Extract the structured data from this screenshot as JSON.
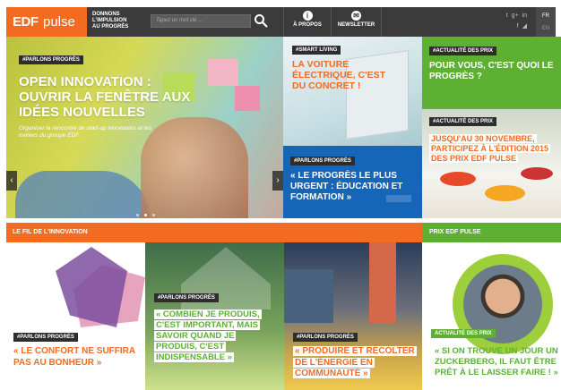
{
  "header": {
    "logo_edf": "EDF",
    "logo_pulse": "pulse",
    "tagline_lines": [
      "DONNONS",
      "L'IMPULSION",
      "AU PROGRÈS"
    ],
    "search_placeholder": "Tapez un mot clé ...",
    "nav": [
      {
        "label": "À PROPOS",
        "icon": "info-icon"
      },
      {
        "label": "NEWSLETTER",
        "icon": "mail-icon"
      }
    ],
    "social": [
      "twitter-icon",
      "google-plus-icon",
      "linkedin-icon",
      "facebook-icon",
      "rss-icon"
    ],
    "languages": {
      "active": "FR",
      "other": "EN"
    }
  },
  "hero": {
    "tag": "#PARLONS PROGRÈS",
    "title": "OPEN INNOVATION : OUVRIR LA FENÊTRE AUX IDÉES NOUVELLES",
    "description": "Organiser la rencontre de start-up innovantes et les métiers du groupe EDF.",
    "prev": "‹",
    "next": "›",
    "slides": 3,
    "active_slide": 2
  },
  "tiles": {
    "smart_living": {
      "tag": "#SMART LIVING",
      "title": "LA VOITURE ÉLECTRIQUE, C'EST DU CONCRET !"
    },
    "education": {
      "tag": "#PARLONS PROGRÈS",
      "title": "« LE PROGRÈS LE PLUS URGENT : ÉDUCATION ET FORMATION »"
    },
    "progres": {
      "tag": "#ACTUALITÉ DES PRIX",
      "title": "POUR VOUS, C'EST QUOI LE PROGRÈS ?"
    },
    "event": {
      "tag": "#ACTUALITÉ DES PRIX",
      "title": "JUSQU'AU 30 NOVEMBRE, PARTICIPEZ À L'ÉDITION 2015 DES PRIX EDF PULSE"
    }
  },
  "sections": {
    "fil": "LE FIL DE L'INNOVATION",
    "prix": "PRIX EDF PULSE"
  },
  "bottom": {
    "comfort": {
      "tag": "#PARLONS PROGRÈS",
      "title": "« LE CONFORT NE SUFFIRA PAS AU BONHEUR »"
    },
    "house": {
      "tag": "#PARLONS PROGRÈS",
      "title": "« COMBIEN JE PRODUIS, C'EST IMPORTANT, MAIS SAVOIR QUAND JE PRODUIS, C'EST INDISPENSABLE »"
    },
    "city": {
      "tag": "#PARLONS PROGRÈS",
      "title": "« PRODUIRE ET RÉCOLTER DE L'ÉNERGIE EN COMMUNAUTÉ »"
    },
    "prize": {
      "tag": "ACTUALITÉ DES PRIX",
      "title": "« SI ON TROUVE UN JOUR UN ZUCKERBERG, IL FAUT ÊTRE PRÊT À LE LAISSER FAIRE ! »"
    }
  },
  "colors": {
    "orange": "#f26b21",
    "green": "#5db032",
    "blue": "#1565b8",
    "dark": "#3b3b3b"
  }
}
